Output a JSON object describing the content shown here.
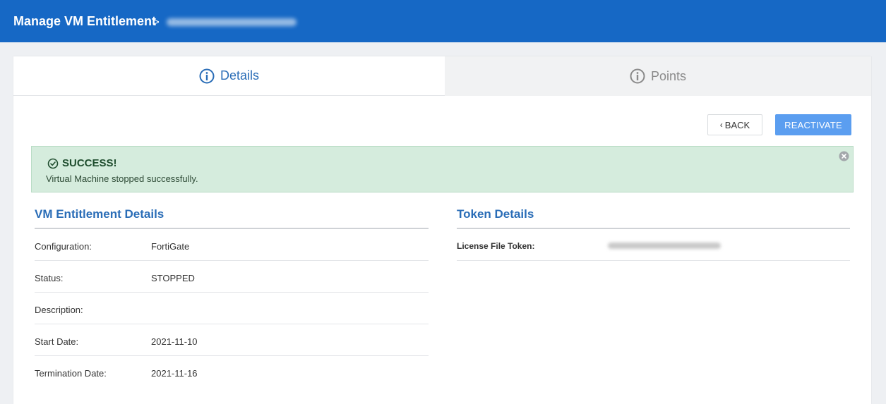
{
  "header": {
    "title": "Manage VM Entitlement",
    "separator": ">",
    "breadcrumb_id_redacted": ""
  },
  "tabs": [
    {
      "label": "Details",
      "icon": "info-icon",
      "active": true
    },
    {
      "label": "Points",
      "icon": "info-icon",
      "active": false
    }
  ],
  "actions": {
    "back_label": "BACK",
    "reactivate_label": "REACTIVATE"
  },
  "alert": {
    "title": "SUCCESS!",
    "message": "Virtual Machine stopped successfully.",
    "icon": "check-circle-icon",
    "close_icon": "close-circle-icon"
  },
  "vm_details": {
    "title": "VM Entitlement Details",
    "rows": [
      {
        "label": "Configuration:",
        "value": "FortiGate"
      },
      {
        "label": "Status:",
        "value": "STOPPED"
      },
      {
        "label": "Description:",
        "value": ""
      },
      {
        "label": "Start Date:",
        "value": "2021-11-10"
      },
      {
        "label": "Termination Date:",
        "value": "2021-11-16"
      }
    ]
  },
  "token_details": {
    "title": "Token Details",
    "rows": [
      {
        "label": "License File Token:",
        "value_redacted": ""
      }
    ]
  },
  "colors": {
    "header_bg": "#1668c5",
    "accent": "#2a6db7",
    "primary_button": "#5b9ef0",
    "success_bg": "#d5ecdd"
  }
}
